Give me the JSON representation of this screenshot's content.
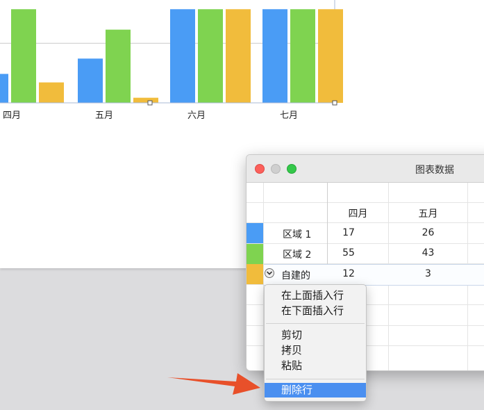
{
  "chart_data": {
    "type": "bar",
    "categories": [
      "四月",
      "五月",
      "六月",
      "七月"
    ],
    "series": [
      {
        "name": "区域 1",
        "color": "#4a9cf5",
        "values": [
          17,
          26,
          55,
          55
        ]
      },
      {
        "name": "区域 2",
        "color": "#7fd350",
        "values": [
          55,
          43,
          55,
          55
        ]
      },
      {
        "name": "自建的",
        "color": "#f1bc3c",
        "values": [
          12,
          3,
          55,
          55
        ]
      }
    ],
    "ylim": [
      0,
      50
    ],
    "gridlines": [
      35
    ],
    "grid": true,
    "legend": "none"
  },
  "window": {
    "title": "图表数据"
  },
  "table": {
    "columns": [
      "四月",
      "五月"
    ],
    "rows": [
      {
        "label": "区域 1",
        "color": "#4a9cf5",
        "values": [
          "17",
          "26"
        ]
      },
      {
        "label": "区域 2",
        "color": "#7fd350",
        "values": [
          "55",
          "43"
        ]
      },
      {
        "label": "自建的",
        "color": "#f1bc3c",
        "values": [
          "12",
          "3"
        ]
      }
    ]
  },
  "context_menu": {
    "items": [
      "在上面插入行",
      "在下面插入行",
      "剪切",
      "拷贝",
      "粘贴",
      "删除行"
    ],
    "selected": "删除行"
  },
  "annotation": {
    "arrow_color": "#e8502a"
  }
}
